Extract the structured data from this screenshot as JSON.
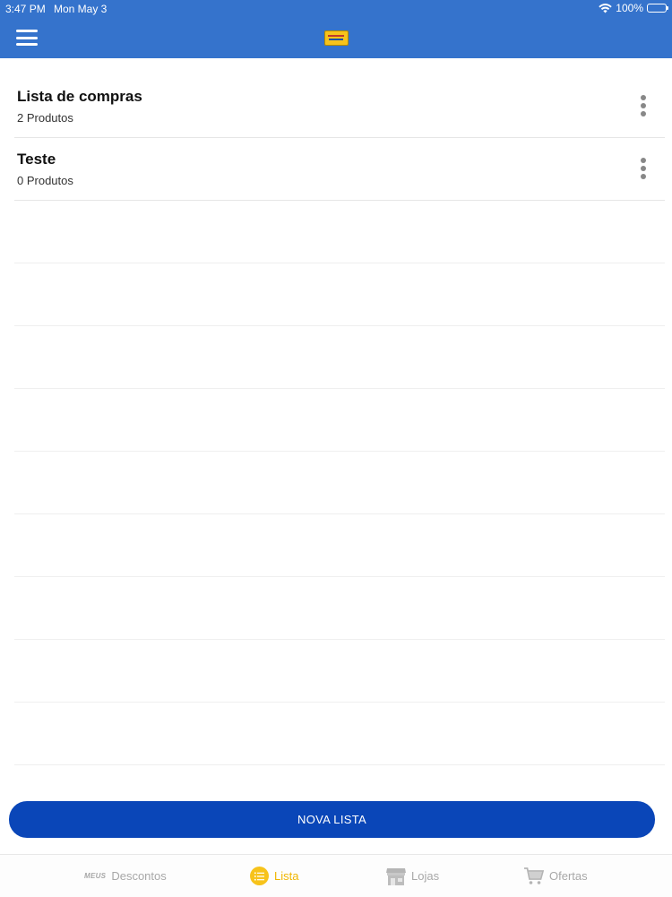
{
  "status": {
    "time": "3:47 PM",
    "date": "Mon May 3",
    "battery": "100%"
  },
  "header": {
    "menu_icon": "hamburger-icon",
    "logo_icon": "dia-logo"
  },
  "lists": [
    {
      "title": "Lista de compras",
      "subtitle": "2 Produtos"
    },
    {
      "title": "Teste",
      "subtitle": "0 Produtos"
    }
  ],
  "actions": {
    "new_list_label": "NOVA LISTA"
  },
  "tabs": [
    {
      "prefix": "MEUS",
      "label": "Descontos",
      "icon": "meus-descontos-icon",
      "active": false
    },
    {
      "label": "Lista",
      "icon": "list-icon",
      "active": true
    },
    {
      "label": "Lojas",
      "icon": "store-icon",
      "active": false
    },
    {
      "label": "Ofertas",
      "icon": "cart-icon",
      "active": false
    }
  ],
  "colors": {
    "header": "#3573cc",
    "primary_button": "#0a46b8",
    "active_tab": "#f0b600",
    "inactive_tab": "#a8a8a8"
  }
}
